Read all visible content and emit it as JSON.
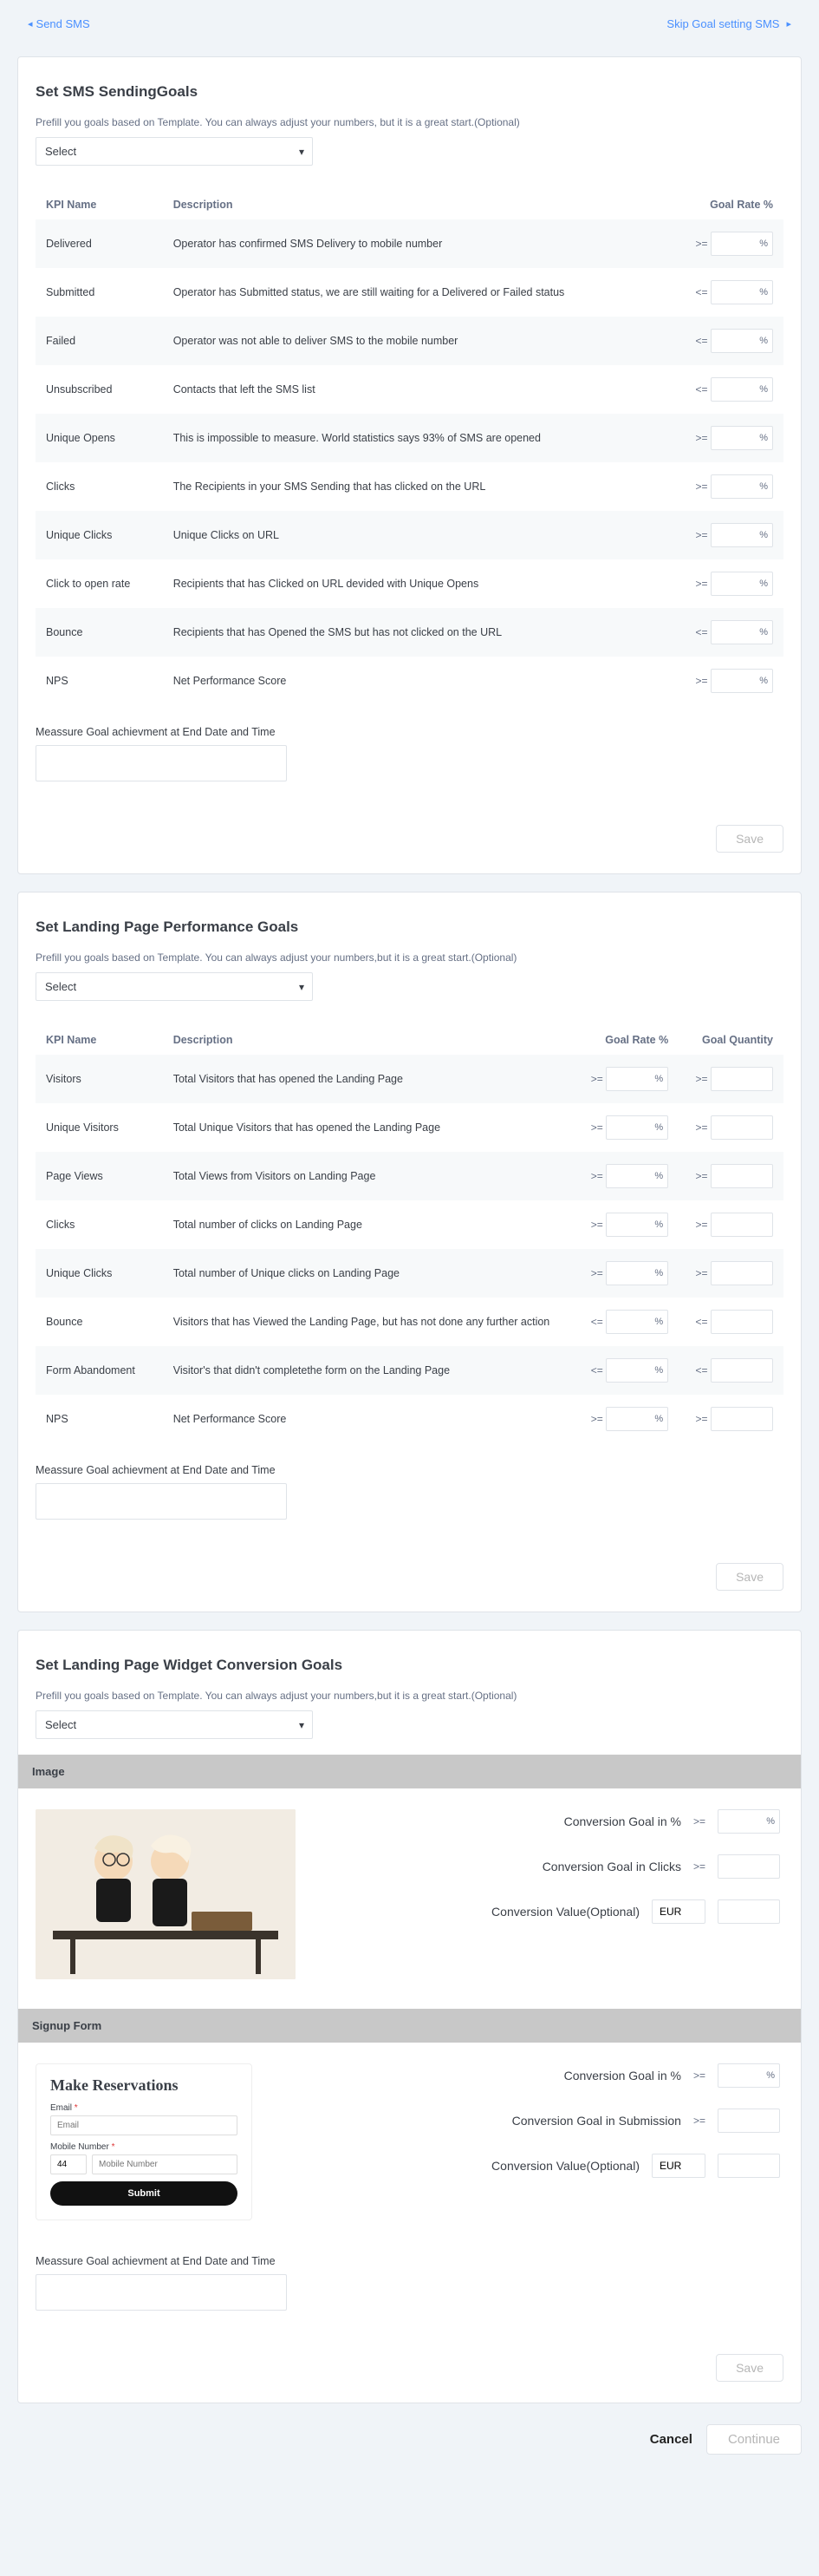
{
  "topbar": {
    "back_label": "Send SMS",
    "skip_label": "Skip Goal setting SMS"
  },
  "sms_goals": {
    "title": "Set SMS SendingGoals",
    "desc": "Prefill you goals based on Template. You can always adjust your numbers, but it is a great start.(Optional)",
    "select_placeholder": "Select",
    "headers": {
      "kpi": "KPI Name",
      "desc": "Description",
      "goal": "Goal Rate %"
    },
    "rows": [
      {
        "kpi": "Delivered",
        "desc": "Operator has confirmed SMS Delivery to mobile number",
        "op": ">="
      },
      {
        "kpi": "Submitted",
        "desc": "Operator has Submitted status, we are still waiting for a Delivered or Failed status",
        "op": "<="
      },
      {
        "kpi": "Failed",
        "desc": "Operator was not able to deliver SMS to the mobile number",
        "op": "<="
      },
      {
        "kpi": "Unsubscribed",
        "desc": "Contacts that left the SMS list",
        "op": "<="
      },
      {
        "kpi": "Unique Opens",
        "desc": "This is impossible to measure. World statistics says 93% of SMS are opened",
        "op": ">="
      },
      {
        "kpi": "Clicks",
        "desc": "The Recipients in your SMS Sending that has clicked on the URL",
        "op": ">="
      },
      {
        "kpi": "Unique Clicks",
        "desc": "Unique Clicks on URL",
        "op": ">="
      },
      {
        "kpi": "Click to open rate",
        "desc": "Recipients that has Clicked on URL devided with Unique Opens",
        "op": ">="
      },
      {
        "kpi": "Bounce",
        "desc": "Recipients that has Opened the SMS but has not clicked on the URL",
        "op": "<="
      },
      {
        "kpi": "NPS",
        "desc": "Net Performance Score",
        "op": ">="
      }
    ],
    "measure_label": "Meassure Goal achievment at End Date and Time",
    "save_label": "Save"
  },
  "landing_goals": {
    "title": "Set Landing Page Performance Goals",
    "desc": "Prefill you goals based on Template. You can always adjust your numbers,but it is a great start.(Optional)",
    "select_placeholder": "Select",
    "headers": {
      "kpi": "KPI Name",
      "desc": "Description",
      "goal_rate": "Goal Rate %",
      "goal_qty": "Goal Quantity"
    },
    "rows": [
      {
        "kpi": "Visitors",
        "desc": "Total Visitors that has opened the Landing Page",
        "op1": ">=",
        "op2": ">="
      },
      {
        "kpi": "Unique Visitors",
        "desc": "Total Unique Visitors that has opened the Landing Page",
        "op1": ">=",
        "op2": ">="
      },
      {
        "kpi": "Page Views",
        "desc": "Total Views from Visitors on Landing Page",
        "op1": ">=",
        "op2": ">="
      },
      {
        "kpi": "Clicks",
        "desc": "Total number of clicks on Landing Page",
        "op1": ">=",
        "op2": ">="
      },
      {
        "kpi": "Unique Clicks",
        "desc": "Total number of Unique clicks on Landing Page",
        "op1": ">=",
        "op2": ">="
      },
      {
        "kpi": "Bounce",
        "desc": "Visitors that has Viewed the Landing Page, but has not done any further action",
        "op1": "<=",
        "op2": "<="
      },
      {
        "kpi": "Form Abandoment",
        "desc": "Visitor's that didn't completethe form on the Landing Page",
        "op1": "<=",
        "op2": "<="
      },
      {
        "kpi": "NPS",
        "desc": "Net Performance Score",
        "op1": ">=",
        "op2": ">="
      }
    ],
    "measure_label": "Meassure Goal achievment at End Date and Time",
    "save_label": "Save"
  },
  "widget_goals": {
    "title": "Set Landing Page Widget Conversion Goals",
    "desc": "Prefill you goals based on Template. You can always adjust your numbers,but it is a great start.(Optional)",
    "select_placeholder": "Select",
    "image_section": {
      "header": "Image",
      "fields": {
        "pct_label": "Conversion Goal in %",
        "pct_op": ">=",
        "clicks_label": "Conversion Goal in Clicks",
        "clicks_op": ">=",
        "value_label": "Conversion Value(Optional)",
        "currency": "EUR"
      }
    },
    "signup_section": {
      "header": "Signup Form",
      "preview": {
        "title": "Make Reservations",
        "email_label": "Email",
        "email_placeholder": "Email",
        "mobile_label": "Mobile Number",
        "cc_value": "44",
        "mobile_placeholder": "Mobile Number",
        "submit_label": "Submit"
      },
      "fields": {
        "pct_label": "Conversion Goal in %",
        "pct_op": ">=",
        "sub_label": "Conversion Goal in Submission",
        "sub_op": ">=",
        "value_label": "Conversion Value(Optional)",
        "currency": "EUR"
      }
    },
    "measure_label": "Meassure Goal achievment at End Date and Time",
    "save_label": "Save"
  },
  "footer": {
    "cancel_label": "Cancel",
    "continue_label": "Continue"
  }
}
